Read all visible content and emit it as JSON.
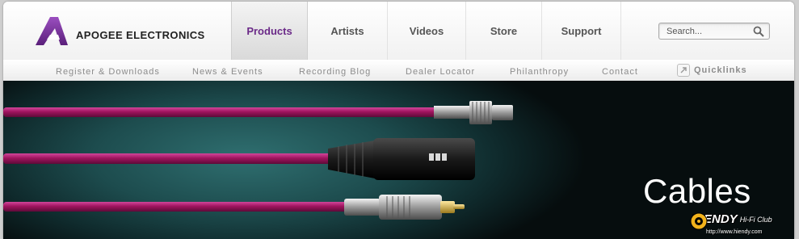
{
  "brand": {
    "name": "APOGEE ELECTRONICS",
    "accent": "#6b2a88",
    "logo_icon": "apogee-a-logo"
  },
  "nav": {
    "items": [
      {
        "label": "Products",
        "active": true
      },
      {
        "label": "Artists",
        "active": false
      },
      {
        "label": "Videos",
        "active": false
      },
      {
        "label": "Store",
        "active": false
      },
      {
        "label": "Support",
        "active": false
      }
    ]
  },
  "search": {
    "placeholder": "Search..."
  },
  "subnav": {
    "items": [
      {
        "label": "Register & Downloads"
      },
      {
        "label": "News & Events"
      },
      {
        "label": "Recording Blog"
      },
      {
        "label": "Dealer Locator"
      },
      {
        "label": "Philanthropy"
      },
      {
        "label": "Contact"
      }
    ],
    "quicklinks": "Quicklinks"
  },
  "banner": {
    "title": "Cables",
    "cable_color": "#a0145f",
    "background": "#1d4c4e"
  },
  "watermark": {
    "brand": "HIENDY",
    "sub": "Hi-Fi Club",
    "url": "http://www.hiendy.com"
  }
}
